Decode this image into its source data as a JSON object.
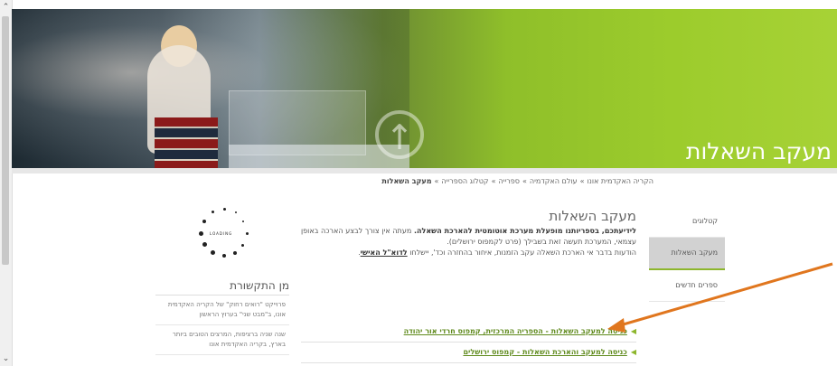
{
  "hero": {
    "title": "מעקב השאלות"
  },
  "breadcrumb": {
    "items": [
      "הקריה האקדמית אונו",
      "עולם האקדמיה",
      "ספרייה",
      "קטלוג הספרייה"
    ],
    "current": "מעקב השאלות",
    "separator": "»"
  },
  "sidenav": {
    "items": [
      {
        "label": "קטלוגים",
        "active": false
      },
      {
        "label": "מעקב השאלות",
        "active": true
      },
      {
        "label": "ספרים חדשים",
        "active": false
      }
    ]
  },
  "main": {
    "title": "מעקב השאלות",
    "intro_bold": "לידיעתכם, בספריותנו מופעלת מערכת אוטומטית להארכת השאלה.",
    "intro_rest": " מעתה אין צורך לבצע הארכה באופן עצמאי, המערכת תעשה זאת בשבילך (פרט לקמפוס ירושלים).",
    "note_text": "הודעות בדבר אי הארכת השאלה עקב הזמנות, איחור בהחזרה וכד', יישלחו ",
    "note_link": "לדוא\"ל האישי",
    "note_end": "."
  },
  "links": [
    {
      "label": "כניסה למעקב השאלות - הספריה המרכזית, קמפוס חרדי אור יהודה"
    },
    {
      "label": "כניסה למעקב והארכת השאלות - קמפוס ירושלים"
    }
  ],
  "loader": {
    "text": "LOADING"
  },
  "contact": {
    "title": "מן התקשורת",
    "items": [
      "פרוייקט \"רואים רחוק\" של הקריה האקדמית אונו, ב\"מבט שני\" בערוץ הראשון",
      "שנה שניה ברציפות, המרצים הטובים ביותר בארץ, בקריה האקדמית אונו"
    ]
  },
  "colors": {
    "accent_green": "#8db62d",
    "link_green": "#5f8a1c",
    "annotation_arrow": "#e0761e"
  },
  "icons": {
    "scroll_up": "chevron-up-icon",
    "scroll_down": "chevron-down-icon",
    "hero_arrow": "arrow-up-circle-icon",
    "link_bullet": "triangle-left-icon"
  }
}
